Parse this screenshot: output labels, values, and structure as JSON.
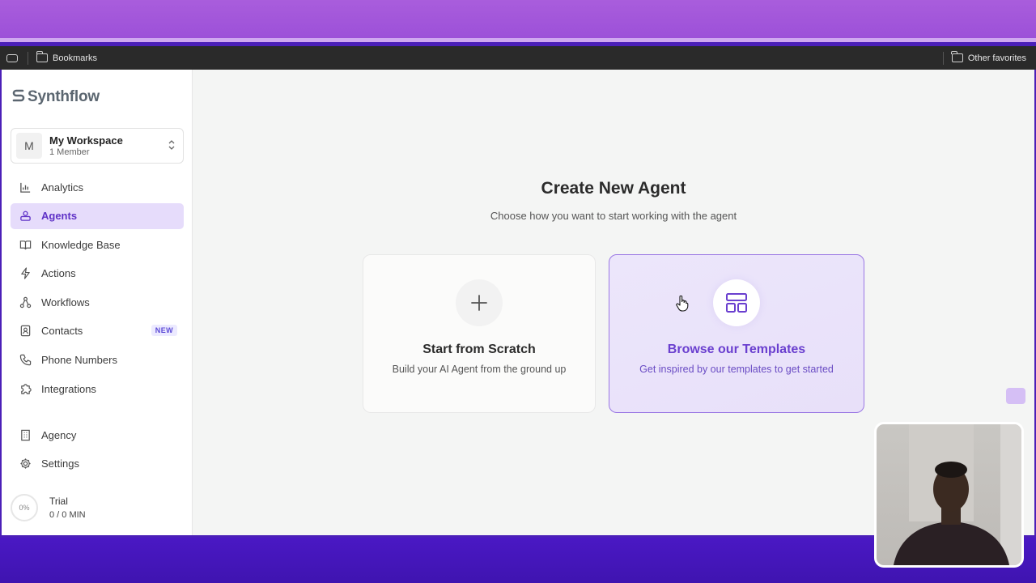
{
  "browser": {
    "bookmarks_label": "Bookmarks",
    "other_favorites_label": "Other favorites"
  },
  "sidebar": {
    "logo": "Synthflow",
    "workspace": {
      "avatar_letter": "M",
      "name": "My Workspace",
      "members": "1 Member"
    },
    "items": [
      {
        "label": "Analytics",
        "icon": "bar-chart-icon",
        "active": false
      },
      {
        "label": "Agents",
        "icon": "agent-icon",
        "active": true
      },
      {
        "label": "Knowledge Base",
        "icon": "book-icon",
        "active": false
      },
      {
        "label": "Actions",
        "icon": "lightning-icon",
        "active": false
      },
      {
        "label": "Workflows",
        "icon": "workflow-icon",
        "active": false
      },
      {
        "label": "Contacts",
        "icon": "contacts-icon",
        "active": false,
        "badge": "NEW"
      },
      {
        "label": "Phone Numbers",
        "icon": "phone-icon",
        "active": false
      },
      {
        "label": "Integrations",
        "icon": "puzzle-icon",
        "active": false
      }
    ],
    "bottom_items": [
      {
        "label": "Agency",
        "icon": "building-icon"
      },
      {
        "label": "Settings",
        "icon": "gear-icon"
      }
    ],
    "trial": {
      "percent": "0%",
      "title": "Trial",
      "usage": "0 / 0 MIN"
    }
  },
  "main": {
    "heading": "Create New Agent",
    "subheading": "Choose how you want to start working with the agent",
    "cards": [
      {
        "title": "Start from Scratch",
        "description": "Build your AI Agent from the ground up",
        "icon": "plus-icon"
      },
      {
        "title": "Browse our Templates",
        "description": "Get inspired by our templates to get started",
        "icon": "layout-template-icon"
      }
    ]
  },
  "colors": {
    "accent": "#6a3fcf",
    "active_nav_bg": "#e6dcfb",
    "card_highlight_border": "#9a77e4"
  }
}
